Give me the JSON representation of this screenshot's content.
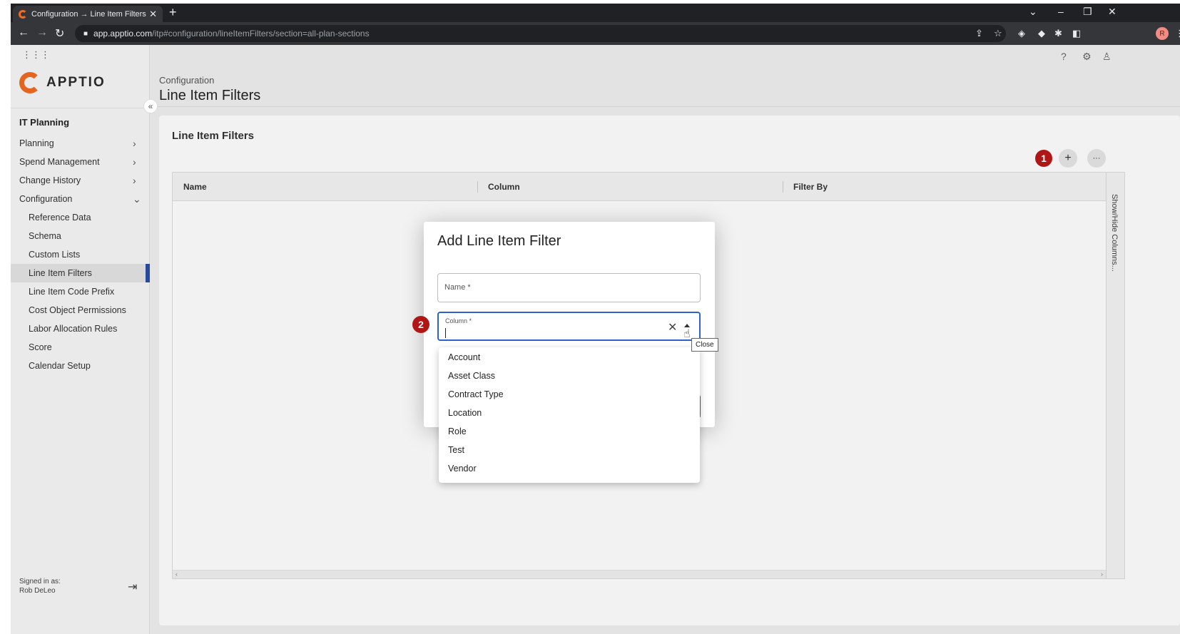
{
  "browser": {
    "tab_title": "Configuration → Line Item Filters",
    "tab_close": "✕",
    "new_tab": "+",
    "url_host": "app.apptio.com",
    "url_path": "/itp#configuration/lineItemFilters/section=all-plan-sections",
    "profile_initial": "R"
  },
  "sidebar": {
    "logo_text": "APPTIO",
    "heading": "IT Planning",
    "collapse_glyph": "«",
    "top_items": [
      {
        "label": "Planning",
        "chevron": "›"
      },
      {
        "label": "Spend Management",
        "chevron": "›"
      },
      {
        "label": "Change History",
        "chevron": "›"
      },
      {
        "label": "Configuration",
        "chevron": "⌄"
      }
    ],
    "sub_items": [
      {
        "label": "Reference Data"
      },
      {
        "label": "Schema"
      },
      {
        "label": "Custom Lists"
      },
      {
        "label": "Line Item Filters"
      },
      {
        "label": "Line Item Code Prefix"
      },
      {
        "label": "Cost Object Permissions"
      },
      {
        "label": "Labor Allocation Rules"
      },
      {
        "label": "Score"
      },
      {
        "label": "Calendar Setup"
      }
    ],
    "active_item": "Line Item Filters",
    "signed_in_label": "Signed in as:",
    "signed_in_user": "Rob DeLeo"
  },
  "header": {
    "breadcrumb": "Configuration",
    "title": "Line Item Filters"
  },
  "panel": {
    "title": "Line Item Filters",
    "badge_1": "1",
    "add_glyph": "+",
    "more_glyph": "···",
    "columns": [
      "Name",
      "Column",
      "Filter By"
    ],
    "show_hide_label": "Show/Hide Columns..."
  },
  "modal": {
    "title": "Add Line Item Filter",
    "name_label": "Name *",
    "column_label": "Column *",
    "clear_glyph": "✕",
    "badge_2": "2",
    "tooltip": "Close"
  },
  "dropdown": {
    "options": [
      "Account",
      "Asset Class",
      "Contract Type",
      "Location",
      "Role",
      "Test",
      "Vendor"
    ]
  },
  "colors": {
    "accent_blue": "#2f62c8",
    "badge_red": "#b01616",
    "brand_orange": "#f26b21",
    "active_indicator": "#2a4fa8"
  }
}
